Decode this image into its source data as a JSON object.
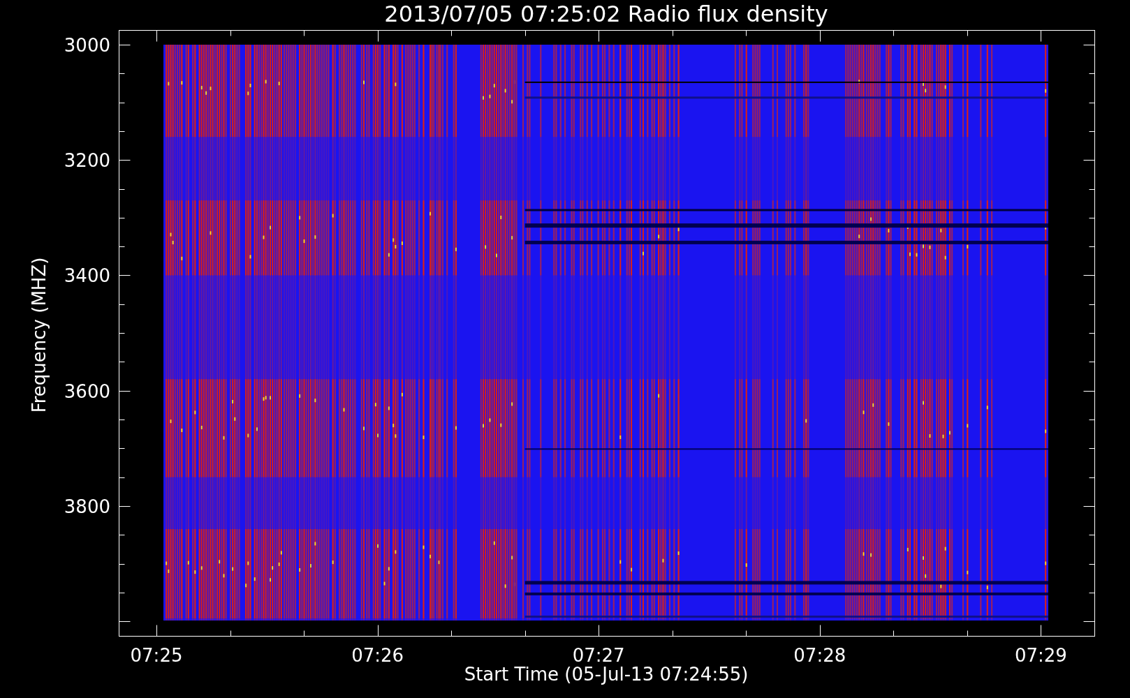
{
  "title": "2013/07/05 07:25:02 Radio flux density",
  "y_axis": {
    "label": "Frequency (MHZ)",
    "ticks": [
      "3000",
      "3200",
      "3400",
      "3600",
      "3800"
    ]
  },
  "x_axis": {
    "label": "Start Time (05-Jul-13 07:24:55)",
    "ticks": [
      "07:25",
      "07:26",
      "07:27",
      "07:28",
      "07:29"
    ]
  }
}
